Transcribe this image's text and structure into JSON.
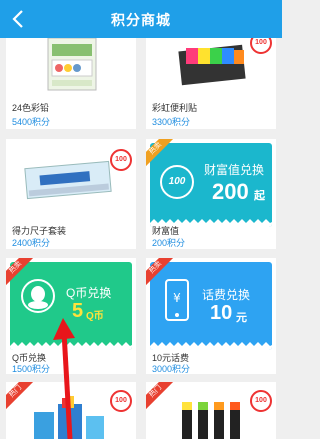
{
  "header": {
    "title": "积分商城"
  },
  "items": [
    {
      "name": "24色彩铅",
      "points": "5400积分",
      "badge": "100"
    },
    {
      "name": "彩虹便利贴",
      "points": "3300积分",
      "badge": "100"
    },
    {
      "name": "得力尺子套装",
      "points": "2400积分",
      "badge": "100"
    },
    {
      "name": "财富值",
      "points": "200积分",
      "ribbon": "热卖",
      "banner_title": "财富值兑换",
      "banner_value": "200",
      "banner_unit": "起",
      "banner_icon_text": "100"
    },
    {
      "name": "Q币兑换",
      "points": "1500积分",
      "ribbon": "热卖",
      "banner_title": "Q币兑换",
      "banner_value": "5",
      "banner_unit": "Q币"
    },
    {
      "name": "10元话费",
      "points": "3000积分",
      "ribbon": "热卖",
      "banner_title": "话费兑换",
      "banner_value": "10",
      "banner_unit": "元"
    },
    {
      "ribbon": "热门",
      "badge": "100"
    },
    {
      "ribbon": "热门",
      "badge": "100"
    }
  ],
  "colors": {
    "header": "#1f9fe8",
    "points": "#1f8de0",
    "teal": "#1bb7cd",
    "green": "#20c98a",
    "blue": "#2ea3f2",
    "arrow": "#e8161b"
  }
}
